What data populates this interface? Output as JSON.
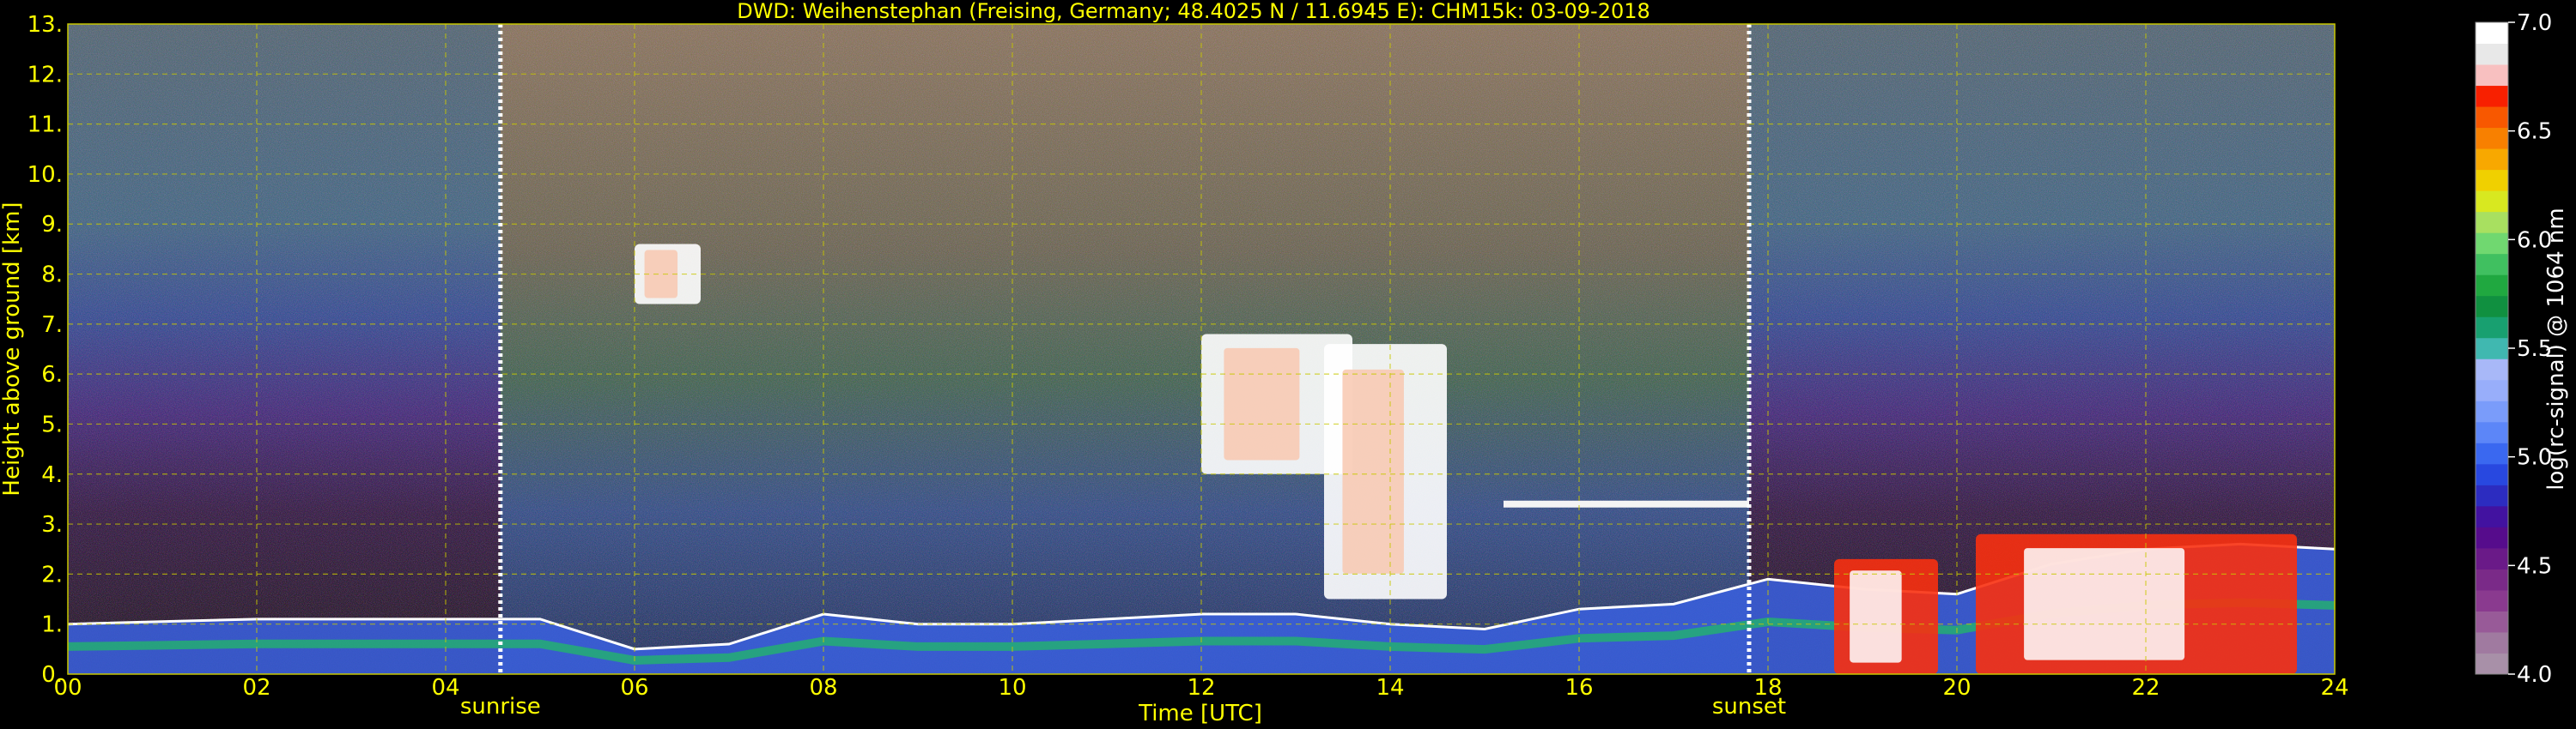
{
  "chart_data": {
    "type": "heatmap",
    "title": "DWD: Weihenstephan (Freising, Germany; 48.4025 N / 11.6945 E):    CHM15k: 03-09-2018",
    "xlabel": "Time [UTC]",
    "ylabel": "Height above ground [km]",
    "xlim": [
      0,
      24
    ],
    "ylim": [
      0,
      13
    ],
    "x_ticks": [
      "00",
      "02",
      "04",
      "06",
      "08",
      "10",
      "12",
      "14",
      "16",
      "18",
      "20",
      "22",
      "24"
    ],
    "y_ticks": [
      "0.",
      "1.",
      "2.",
      "3.",
      "4.",
      "5.",
      "6.",
      "7.",
      "8.",
      "9.",
      "10.",
      "11.",
      "12.",
      "13."
    ],
    "grid": true,
    "markers": [
      {
        "label": "sunrise",
        "x": 4.58
      },
      {
        "label": "sunset",
        "x": 17.8
      }
    ],
    "colorbar": {
      "label": "log(rc-signal) @ 1064 nm",
      "range": [
        4.0,
        7.0
      ],
      "ticks": [
        "4.0",
        "4.5",
        "5.0",
        "5.5",
        "6.0",
        "6.5",
        "7.0"
      ],
      "colors": [
        "#a890a8",
        "#a07aa0",
        "#985a98",
        "#8a3a8f",
        "#7a2a88",
        "#6a1a88",
        "#560c8c",
        "#4212a0",
        "#2c2cc0",
        "#2848e0",
        "#3a68f0",
        "#5c86f8",
        "#7a9cfa",
        "#98aefa",
        "#a8b8f8",
        "#40b8b0",
        "#18a070",
        "#109040",
        "#20a840",
        "#40c060",
        "#70d870",
        "#a8e060",
        "#d8e820",
        "#f0d000",
        "#f8a800",
        "#f88000",
        "#f85800",
        "#f82000",
        "#f8c0c0",
        "#e8e8e8",
        "#ffffff"
      ]
    },
    "features": [
      {
        "type": "boundary-layer",
        "x": [
          0,
          2,
          4,
          5,
          6,
          7,
          8,
          9,
          10,
          11,
          12,
          13,
          14,
          15,
          16,
          17,
          18,
          19,
          20,
          21,
          22,
          23,
          24
        ],
        "y": [
          1.0,
          1.1,
          1.1,
          1.1,
          0.5,
          0.6,
          1.2,
          1.0,
          1.0,
          1.1,
          1.2,
          1.2,
          1.0,
          0.9,
          1.3,
          1.4,
          1.9,
          1.7,
          1.6,
          2.2,
          2.5,
          2.6,
          2.5
        ]
      },
      {
        "type": "cloud",
        "x_range": [
          6.0,
          6.7
        ],
        "y_range": [
          7.4,
          8.6
        ]
      },
      {
        "type": "cloud",
        "x_range": [
          12.0,
          13.6
        ],
        "y_range": [
          4.0,
          6.8
        ]
      },
      {
        "type": "cloud",
        "x_range": [
          13.3,
          14.6
        ],
        "y_range": [
          1.5,
          6.6
        ]
      },
      {
        "type": "cloud-layer",
        "x_range": [
          15.2,
          17.8
        ],
        "y": 3.4
      },
      {
        "type": "low-cloud",
        "x_range": [
          18.7,
          19.8
        ],
        "y_range": [
          0.0,
          2.3
        ]
      },
      {
        "type": "low-cloud",
        "x_range": [
          20.2,
          23.6
        ],
        "y_range": [
          0.0,
          2.8
        ]
      }
    ]
  }
}
